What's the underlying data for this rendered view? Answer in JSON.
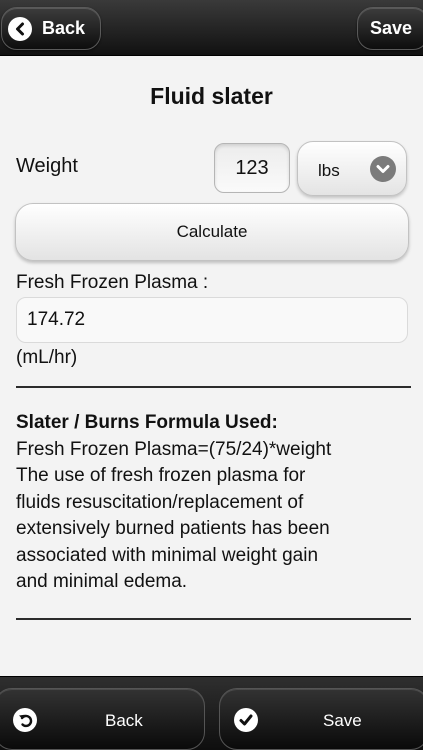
{
  "header": {
    "back_label": "Back",
    "save_label": "Save"
  },
  "page": {
    "title": "Fluid slater"
  },
  "form": {
    "weight_label": "Weight",
    "weight_value": "123",
    "unit_selected": "lbs",
    "calculate_label": "Calculate"
  },
  "result": {
    "label": "Fresh Frozen Plasma :",
    "value": "174.72",
    "unit": "(mL/hr)"
  },
  "info": {
    "heading": "Slater / Burns Formula Used:",
    "formula": "Fresh Frozen Plasma=(75/24)*weight",
    "lines": [
      "The use of fresh frozen plasma for",
      "fluids resuscitation/replacement of",
      "extensively burned patients has been",
      "associated with minimal weight gain",
      "and minimal edema."
    ]
  },
  "toolbar": {
    "back_label": "Back",
    "save_label": "Save"
  },
  "icons": {
    "top_back": "back-arrow-icon",
    "unit_dropdown": "chevron-down-icon",
    "toolbar_back": "undo-arrow-icon",
    "toolbar_save": "checkmark-icon"
  }
}
